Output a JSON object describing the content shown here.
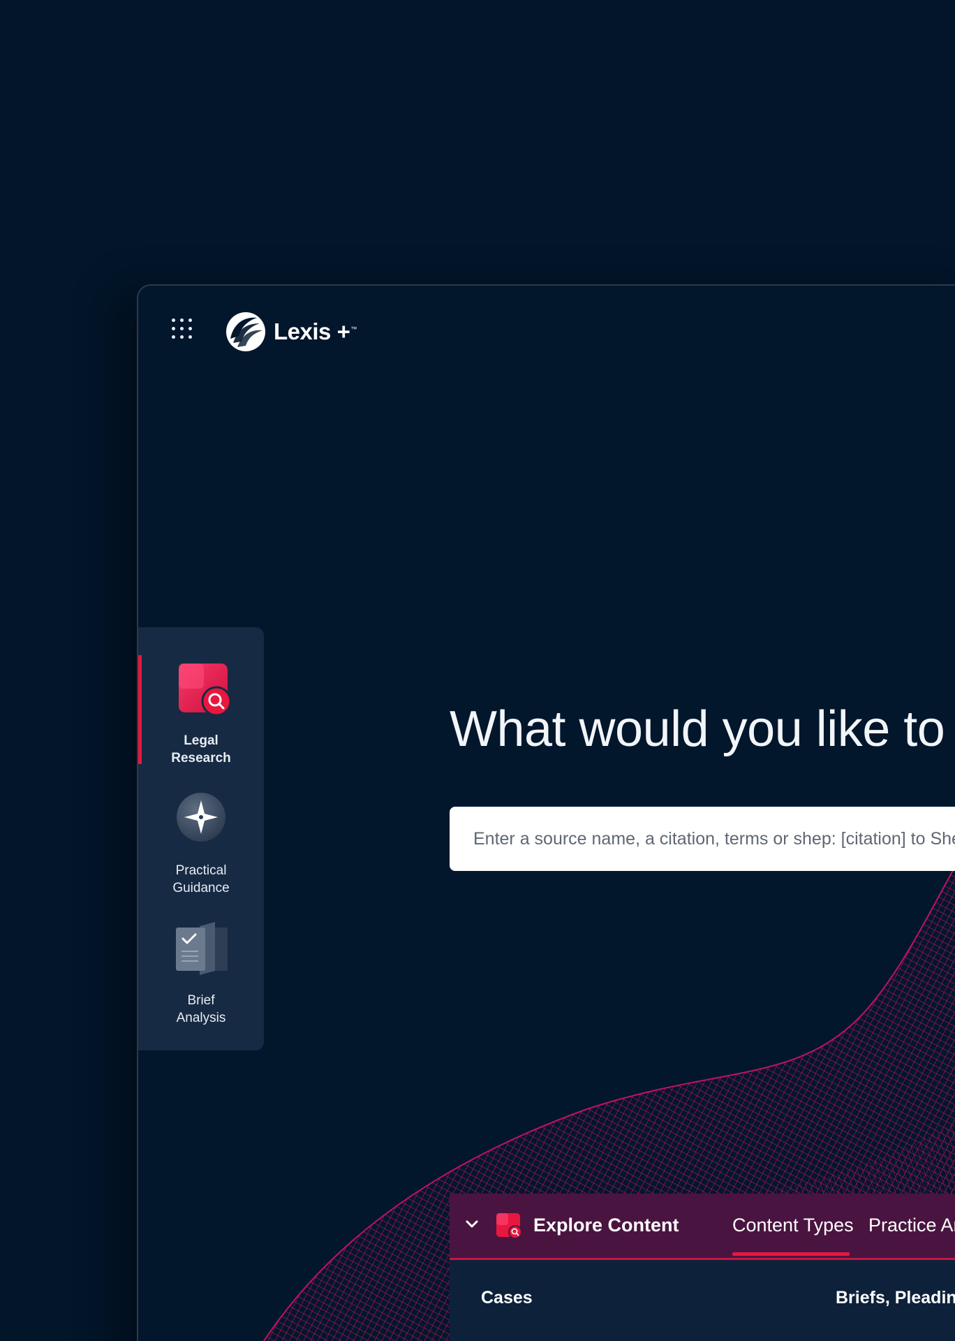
{
  "header": {
    "logo_text": "Lexis",
    "logo_plus": "+",
    "logo_tm": "™"
  },
  "sidebar": {
    "items": [
      {
        "line1": "Legal",
        "line2": "Research",
        "active": true
      },
      {
        "line1": "Practical",
        "line2": "Guidance",
        "active": false
      },
      {
        "line1": "Brief",
        "line2": "Analysis",
        "active": false
      }
    ]
  },
  "main": {
    "headline": "What would you like to research today?",
    "search_placeholder": "Enter a source name, a citation, terms or shep: [citation] to Shepardize®"
  },
  "explore": {
    "title": "Explore Content",
    "tabs": [
      {
        "label": "Content Types",
        "selected": true
      },
      {
        "label": "Practice Areas",
        "selected": false
      }
    ],
    "links": [
      "Cases",
      "Briefs, Pleadings and Motions"
    ]
  },
  "colors": {
    "background": "#021529",
    "accent_red": "#e8173e",
    "wave_magenta": "#c3125f",
    "sidebar": "#162a43",
    "explore_bar": "#4a1441"
  },
  "icons": {
    "apps": "app-grid-icon",
    "legal_research": "legal-research-icon",
    "practical_guidance": "compass-star-icon",
    "brief_analysis": "brief-document-icon",
    "explore_chevron": "chevron-down-icon"
  }
}
